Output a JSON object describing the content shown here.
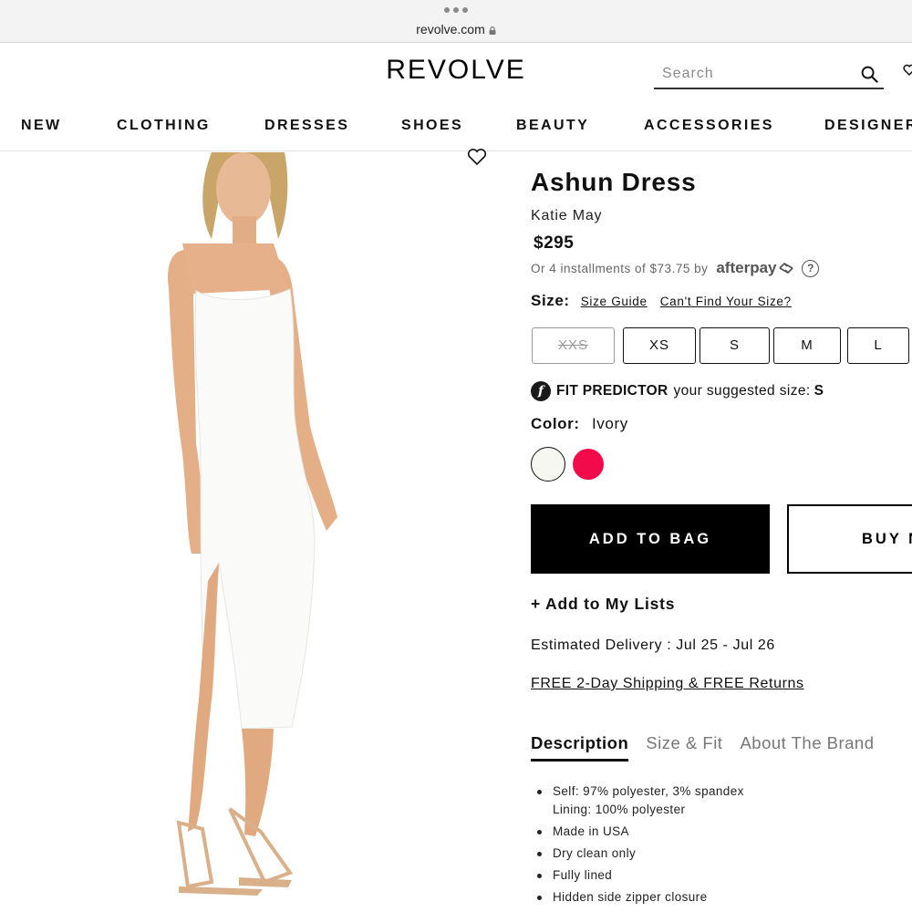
{
  "browser": {
    "url": "revolve.com"
  },
  "header": {
    "logo": "REVOLVE",
    "search_placeholder": "Search"
  },
  "nav": {
    "items": [
      "NEW",
      "CLOTHING",
      "DRESSES",
      "SHOES",
      "BEAUTY",
      "ACCESSORIES",
      "DESIGNER"
    ]
  },
  "product": {
    "title": "Ashun Dress",
    "brand": "Katie May",
    "price": "$295",
    "installments_text": "Or 4 installments of $73.75 by",
    "afterpay_label": "afterpay",
    "help_glyph": "?",
    "size": {
      "label": "Size:",
      "guide_link": "Size Guide",
      "cant_find_link": "Can't Find Your Size?",
      "options": [
        {
          "label": "XXS",
          "available": false
        },
        {
          "label": "XS",
          "available": true
        },
        {
          "label": "S",
          "available": true
        },
        {
          "label": "M",
          "available": true
        },
        {
          "label": "L",
          "available": true
        }
      ]
    },
    "fit_predictor": {
      "icon_glyph": "f",
      "label": "FIT PREDICTOR",
      "text": "your suggested size:",
      "size": "S"
    },
    "color": {
      "label": "Color:",
      "selected": "Ivory",
      "swatches": [
        {
          "name": "ivory",
          "hex": "#f7f7f2"
        },
        {
          "name": "pink",
          "hex": "#f20a4b"
        }
      ]
    },
    "buttons": {
      "add_to_bag": "ADD TO BAG",
      "buy_now": "BUY N"
    },
    "add_to_lists": "+ Add to My Lists",
    "delivery": "Estimated Delivery : Jul 25 - Jul 26",
    "shipping": "FREE 2-Day Shipping & FREE Returns",
    "tabs": [
      "Description",
      "Size & Fit",
      "About The Brand"
    ],
    "description": [
      [
        "Self: 97% polyester, 3% spandex",
        "Lining: 100% polyester"
      ],
      [
        "Made in USA"
      ],
      [
        "Dry clean only"
      ],
      [
        "Fully lined"
      ],
      [
        "Hidden side zipper closure"
      ]
    ]
  }
}
